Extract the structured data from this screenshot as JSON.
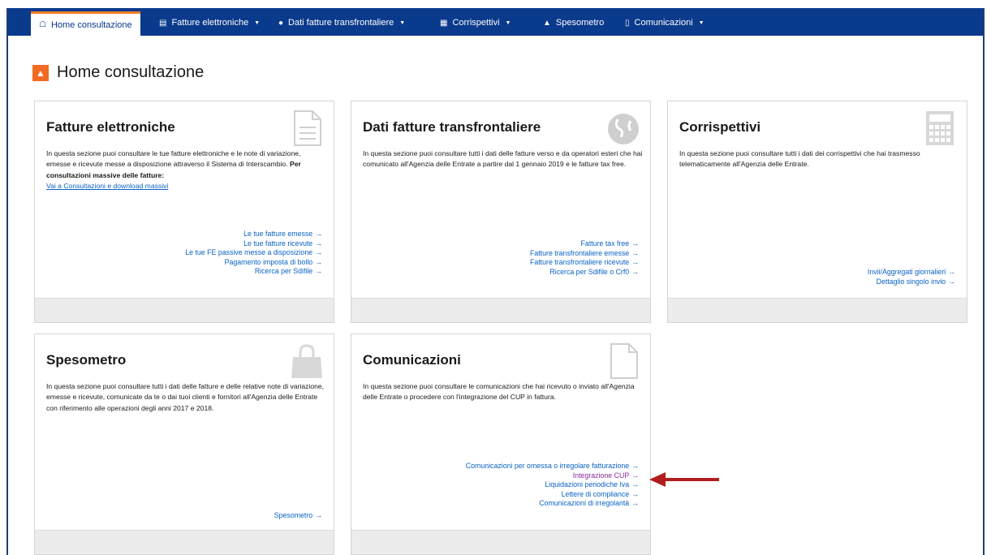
{
  "nav": {
    "items": [
      {
        "label": "Home consultazione",
        "icon": "home-icon",
        "has_caret": false,
        "active": true
      },
      {
        "label": "Fatture elettroniche",
        "icon": "document-icon",
        "has_caret": true,
        "active": false
      },
      {
        "label": "Dati fatture transfrontaliere",
        "icon": "globe-icon",
        "has_caret": true,
        "active": false
      },
      {
        "label": "Corrispettivi",
        "icon": "calculator-icon",
        "has_caret": true,
        "active": false
      },
      {
        "label": "Spesometro",
        "icon": "bag-icon",
        "has_caret": false,
        "active": false
      },
      {
        "label": "Comunicazioni",
        "icon": "file-icon",
        "has_caret": true,
        "active": false
      }
    ]
  },
  "page": {
    "title": "Home consultazione"
  },
  "cards": {
    "fatture": {
      "title": "Fatture elettroniche",
      "desc_a": "In questa sezione puoi consultare le tue fatture elettroniche e le note di variazione, emesse e ricevute messe a disposizione attraverso il Sistema di Interscambio.",
      "desc_bold": "Per consultazioni massive delle fatture:",
      "desc_link": "Vai a Consultazioni e download massivi",
      "links": [
        "Le tue fatture emesse",
        "Le tue fatture ricevute",
        "Le tue FE passive messe a disposizione",
        "Pagamento imposta di bollo",
        "Ricerca per Sdifile"
      ]
    },
    "transfrontaliere": {
      "title": "Dati fatture transfrontaliere",
      "desc": "In questa sezione puoi consultare tutti i dati delle fatture verso e da operatori esteri che hai comunicato all'Agenzia delle Entrate a partire dal 1 gennaio 2019 e le fatture tax free.",
      "links": [
        "Fatture tax free",
        "Fatture transfrontaliere emesse",
        "Fatture transfrontaliere ricevute",
        "Ricerca per Sdifile o Crf0"
      ]
    },
    "corrispettivi": {
      "title": "Corrispettivi",
      "desc": "In questa sezione puoi consultare tutti i dati dei corrispettivi che hai trasmesso telematicamente all'Agenzia delle Entrate.",
      "links": [
        "Invii/Aggregati giornalieri",
        "Dettaglio singolo invio"
      ]
    },
    "spesometro": {
      "title": "Spesometro",
      "desc": "In questa sezione puoi consultare tutti i dati delle fatture e delle relative note di variazione, emesse e ricevute, comunicate da te o dai tuoi clienti e fornitori all'Agenzia delle Entrate con riferimento alle operazioni degli anni 2017 e 2018.",
      "links": [
        "Spesometro"
      ]
    },
    "comunicazioni": {
      "title": "Comunicazioni",
      "desc": "In questa sezione puoi consultare le comunicazioni che hai ricevuto o inviato all'Agenzia delle Entrate o procedere con l'integrazione del CUP in fattura.",
      "links": [
        "Comunicazioni per omessa o irregolare fatturazione",
        "Integrazione CUP",
        "Liquidazioni periodiche Iva",
        "Lettere di compliance",
        "Comunicazioni di irregolarità"
      ]
    }
  },
  "arrow_symbol": "→",
  "colors": {
    "navbar": "#0a3a8c",
    "active_tab_accent": "#f07c28",
    "home_badge": "#f26b21",
    "link": "#0b62c4",
    "visited_link": "#8a2aa0",
    "annotation_arrow": "#b21e1e"
  }
}
